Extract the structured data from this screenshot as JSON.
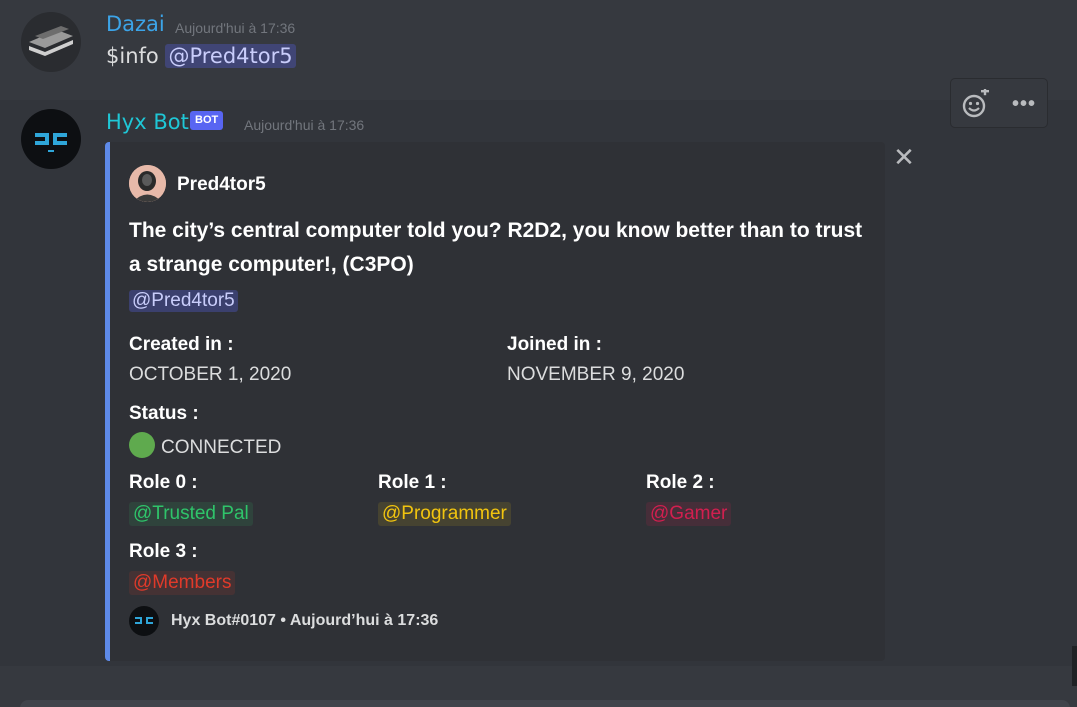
{
  "messages": [
    {
      "author": "Dazai",
      "timestamp": "Aujourd'hui à 17:36",
      "text": "$info",
      "mention": "@Pred4tor5",
      "name_color": "#3ca4e8"
    },
    {
      "author": "Hyx Bot",
      "bot_tag": "BOT",
      "timestamp": "Aujourd'hui à 17:36",
      "name_color": "#1fc7d6"
    }
  ],
  "toolbar": {
    "react_icon": "add-reaction-icon",
    "more_icon": "more-icon",
    "more_label": "•••"
  },
  "embed": {
    "accent_color": "#5e8ae8",
    "close_label": "✕",
    "author_name": "Pred4tor5",
    "description": "The city’s central computer told you?  R2D2, you know better than to trust a strange computer!, (C3PO)",
    "mention": "@Pred4tor5",
    "fields": {
      "created": {
        "name": "Created in :",
        "value": "OCTOBER 1, 2020"
      },
      "joined": {
        "name": "Joined in :",
        "value": "NOVEMBER 9, 2020"
      },
      "status": {
        "name": "Status :",
        "value": "CONNECTED",
        "dot_color": "#5faa4e"
      },
      "role0": {
        "name": "Role 0 :",
        "value": "@Trusted Pal",
        "color": "#2fc46a"
      },
      "role1": {
        "name": "Role 1 :",
        "value": "@Programmer",
        "color": "#f1c40f"
      },
      "role2": {
        "name": "Role 2 :",
        "value": "@Gamer",
        "color": "#d21f4f"
      },
      "role3": {
        "name": "Role 3 :",
        "value": "@Members",
        "color": "#e03a2a"
      }
    },
    "footer": "Hyx Bot#0107 • Aujourd’hui à 17:36"
  }
}
